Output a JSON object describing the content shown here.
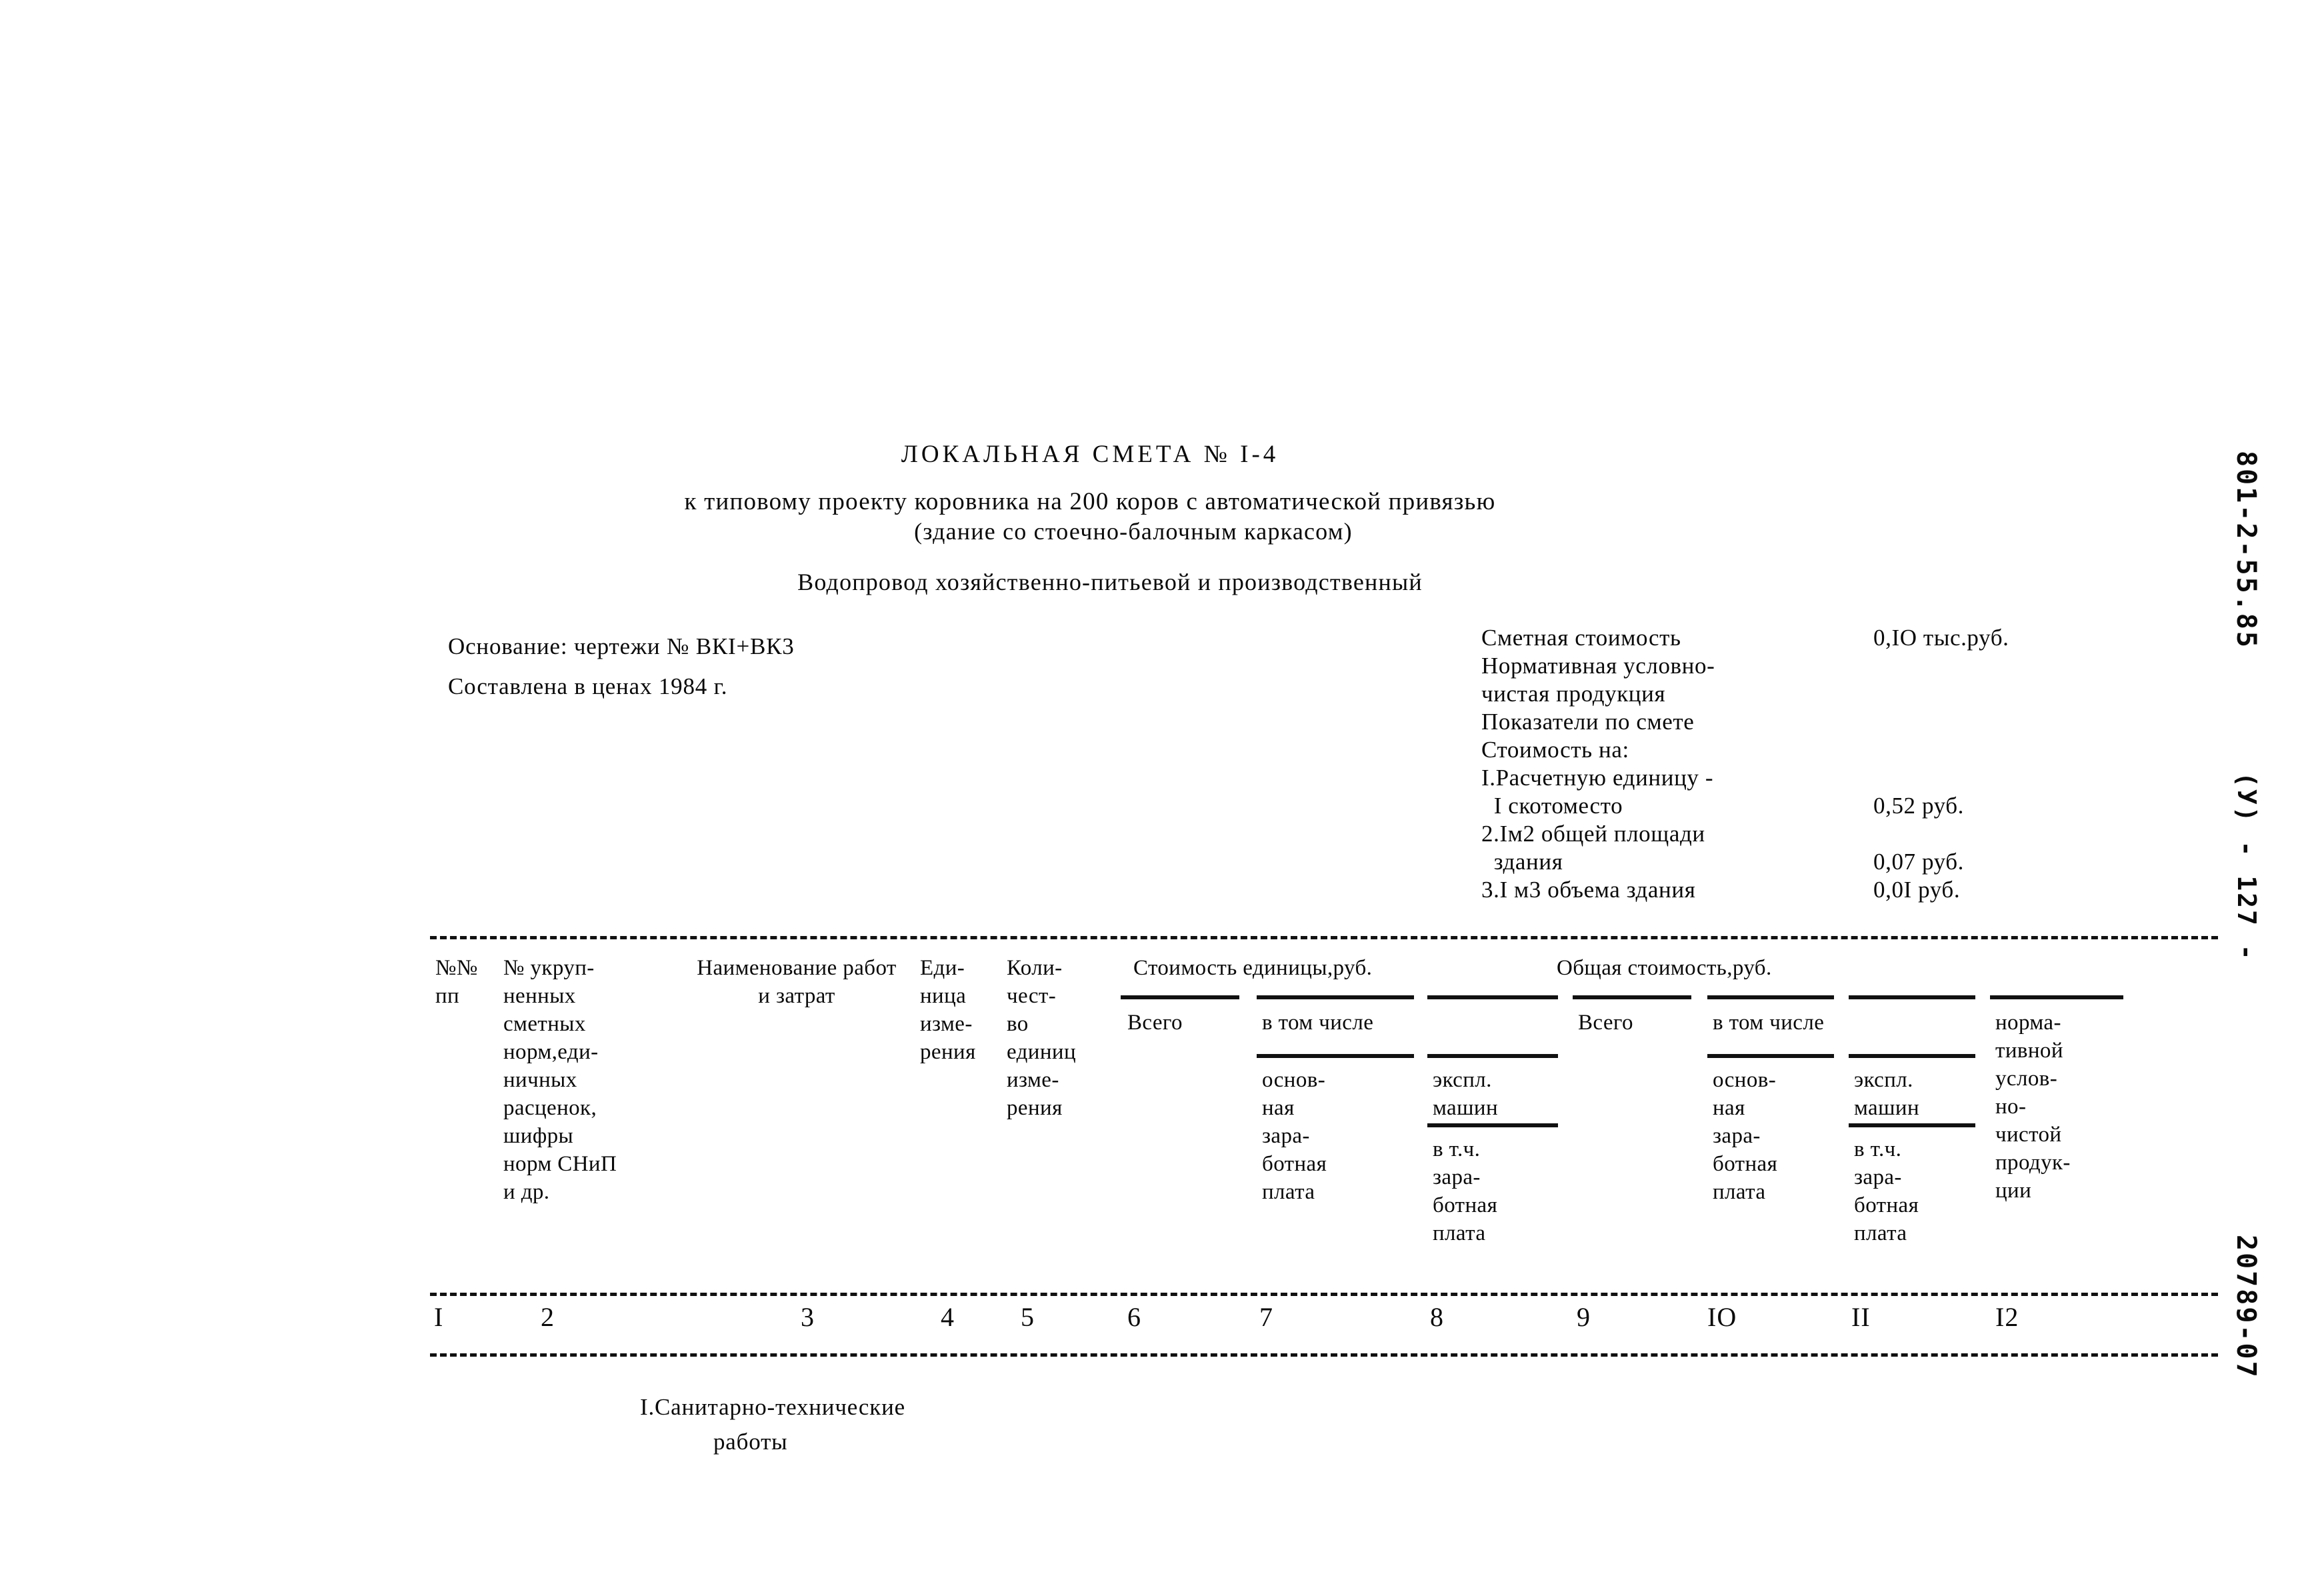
{
  "title_block": {
    "doc_title": "ЛОКАЛЬНАЯ СМЕТА № I-4",
    "subtitle_1": "к типовому проекту коровника на 200 коров с автоматической привязью",
    "subtitle_2": "(здание со стоечно-балочным каркасом)",
    "subtitle_3": "Водопровод хозяйственно-питьевой и производственный"
  },
  "info_left": {
    "basis": "Основание: чертежи № ВКI+ВК3",
    "prices": "Составлена в ценах 1984 г."
  },
  "info_right": {
    "rows": [
      {
        "label": "Сметная стоимость",
        "value": "0,IO тыс.руб."
      },
      {
        "label": "Нормативная условно-",
        "value": ""
      },
      {
        "label": "чистая продукция",
        "value": ""
      },
      {
        "label": "Показатели по смете",
        "value": ""
      },
      {
        "label": "Стоимость на:",
        "value": ""
      },
      {
        "label": "I.Расчетную единицу -",
        "value": ""
      },
      {
        "label": "  I скотоместо",
        "value": "0,52 руб."
      },
      {
        "label": "2.Iм2 общей площади",
        "value": ""
      },
      {
        "label": "  здания",
        "value": "0,07 руб."
      },
      {
        "label": "3.I м3 объема здания",
        "value": "0,0I руб."
      }
    ]
  },
  "table": {
    "headers": {
      "col1": "№№\nпп",
      "col2": "№ укруп-\nненных\nсметных\nнорм,еди-\nничных\nрасценок,\nшифры\nнорм СНиП\nи др.",
      "col3": "Наименование работ\nи затрат",
      "col4": "Еди-\nница\nизме-\nрения",
      "col5": "Коли-\nчест-\nво\nединиц\nизме-\nрения",
      "group_unit_cost": "Стоимость единицы,руб.",
      "group_total_cost": "Общая стоимость,руб.",
      "unit_total": "Всего",
      "unit_among": "в том числе",
      "unit_basic_wage": "основ-\nная\nзара-\nботная\nплата",
      "unit_machines": "экспл.\nмашин",
      "unit_machines_wage": "в т.ч.\nзара-\nботная\nплата",
      "total_total": "Всего",
      "total_among": "в том числе",
      "total_basic_wage": "основ-\nная\nзара-\nботная\nплата",
      "total_machines": "экспл.\nмашин",
      "total_machines_wage": "в т.ч.\nзара-\nботная\nплата",
      "total_npp": "норма-\nтивной\nуслов-\nно-\nчистой\nпродук-\nции"
    },
    "column_numbers": [
      "I",
      "2",
      "3",
      "4",
      "5",
      "6",
      "7",
      "8",
      "9",
      "IO",
      "II",
      "I2"
    ]
  },
  "section_heading": {
    "line1": "I.Санитарно-технические",
    "line2": "работы"
  },
  "margins": {
    "code_top": "801-2-55.85",
    "page_ref": "(У) - 127 -",
    "code_bottom": "20789-07"
  }
}
